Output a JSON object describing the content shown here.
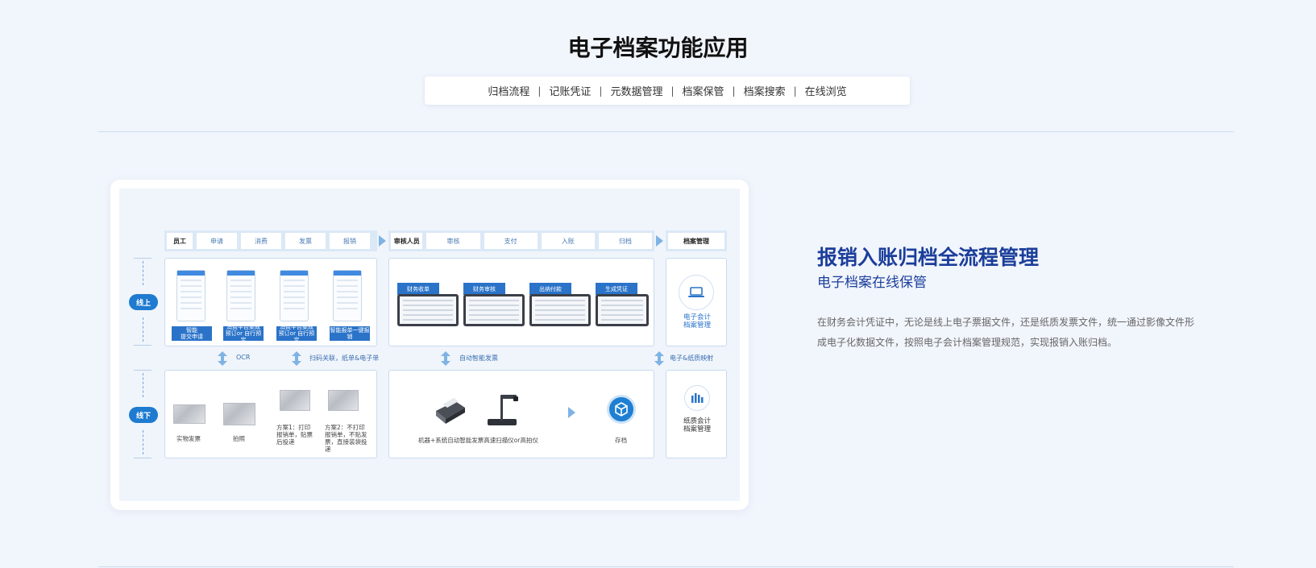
{
  "page_title": "电子档案功能应用",
  "tabs": [
    "归档流程",
    "记账凭证",
    "元数据管理",
    "档案保管",
    "档案搜索",
    "在线浏览"
  ],
  "diagram": {
    "header_row": {
      "employee": "员工",
      "employee_steps": [
        "申请",
        "消费",
        "发票",
        "报销"
      ],
      "reviewer": "审核人员",
      "reviewer_steps": [
        "审核",
        "支付",
        "入账",
        "归档"
      ],
      "archive": "档案管理"
    },
    "lane_online": "线上",
    "lane_offline": "线下",
    "online_employee_labels": [
      "智能\n提交申请",
      "消费平台集成\n预订or 自行预定",
      "消费平台集成\n预订or 自行预定",
      "智能报单一键报\n销"
    ],
    "online_reviewer_tabs": [
      "财务收单",
      "财务审核",
      "出纳付款",
      "生成凭证"
    ],
    "online_archive_label": "电子会计\n档案管理",
    "middle": {
      "ocr": "OCR",
      "scan_link": "扫码关联，纸单&电子单",
      "auto_scan": "自动智能发票",
      "mapping": "电子&纸质映射"
    },
    "offline_labels": {
      "physical_invoice": "实物发票",
      "photo": "拍照",
      "plan1": "方案1：打印\n报销单，贴票\n后投递",
      "plan2": "方案2：不打印\n报销单，不贴发\n票，直接装袋投\n递",
      "scanner": "机器+系统自动智能发票高速扫描仪or高拍仪",
      "store": "存档",
      "paper_archive": "纸质会计\n档案管理"
    },
    "icons": [
      "laptop-icon",
      "bar-chart-icon",
      "box-icon",
      "arrow-right-icon",
      "double-arrow-icon"
    ]
  },
  "section": {
    "title": "报销入账归档全流程管理",
    "subtitle": "电子档案在线保管",
    "description": "在财务会计凭证中，无论是线上电子票据文件，还是纸质发票文件，统一通过影像文件形成电子化数据文件，按照电子会计档案管理规范，实现报销入账归档。"
  },
  "colors": {
    "title_blue": "#1b3e9a",
    "accent_blue": "#2a73c9",
    "pill_blue": "#1f7bd0",
    "bg": "#f1f5fc"
  }
}
